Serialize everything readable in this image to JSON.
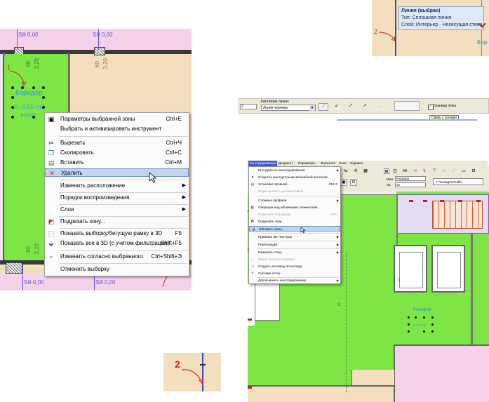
{
  "floor_plan_left": {
    "sill_labels": [
      "Sill 0,00",
      "Sill 0,00",
      "Sill 0,00",
      "Sill 0,00"
    ],
    "dim_labels": [
      "60",
      "3,20",
      "60",
      "3,20",
      "60",
      "3,20"
    ],
    "zone_name": "Коридор",
    "zone_area": "A: 9,55 m2",
    "zone_extra": "корид",
    "marker": "1",
    "colors": {
      "zone": "#7ee644",
      "room": "#f3dfbd",
      "corridor": "#f5d2ea",
      "sill": "#6a4fd8"
    }
  },
  "context_menu": {
    "items": [
      {
        "icon": "zone-settings-icon",
        "label": "Параметры выбранной зоны",
        "shortcut": "Ctrl+E"
      },
      {
        "icon": "",
        "label": "Выбрать и активизировать инструмент",
        "shortcut": ""
      },
      {
        "icon": "scissors-icon",
        "label": "Вырезать",
        "shortcut": "Ctrl+Ч"
      },
      {
        "icon": "copy-icon",
        "label": "Скопировать",
        "shortcut": "Ctrl+С"
      },
      {
        "icon": "paste-icon",
        "label": "Вставить",
        "shortcut": "Ctrl+М"
      },
      {
        "icon": "delete-x-icon",
        "label": "Удалить",
        "shortcut": ""
      },
      {
        "icon": "",
        "label": "Изменить расположение",
        "shortcut": ""
      },
      {
        "icon": "",
        "label": "Порядок воспроизведения",
        "shortcut": ""
      },
      {
        "icon": "",
        "label": "Слои",
        "shortcut": ""
      },
      {
        "icon": "trim-zone-icon",
        "label": "Подрезать зону...",
        "shortcut": ""
      },
      {
        "icon": "3d-window-icon",
        "label": "Показать выборку/бегущую рамку в 3D",
        "shortcut": "F5"
      },
      {
        "icon": "3d-all-icon",
        "label": "Показать все в 3D (с учетом фильтрации)",
        "shortcut": "Shift+F5"
      },
      {
        "icon": "modify-selected-icon",
        "label": "Изменить согласно выбранного",
        "shortcut": "Ctrl+Shift+Э"
      },
      {
        "icon": "",
        "label": "Отменить выборку",
        "shortcut": ""
      }
    ]
  },
  "tooltip_top_right": {
    "title": "Линия (выбран)",
    "line1": "Тип: Сплошная линия",
    "line2": "Слой: Интерьер - Несесущая стена",
    "marker": "2",
    "side_label": "Кор"
  },
  "line_toolbar": {
    "left_value": "2",
    "category_label": "Категория линии:",
    "category_value": "Линия чертежа",
    "checkbox_label": "Граница зоны",
    "tooltip": "Связь с зонами"
  },
  "small_detail": {
    "marker": "2"
  },
  "app_window": {
    "menubar": [
      "Конструирование",
      "Документ",
      "Параметры",
      "Teamwork",
      "Окно",
      "Справка"
    ],
    "name_label": "Имя:",
    "name_value": "Коридор",
    "number_label": "№:",
    "number_value": "02",
    "category_value": "7  Passages/Traffic",
    "menu_items": [
      {
        "icon": "tools-icon",
        "label": "Инструменты конструирования",
        "shortcut": "",
        "state": "normal"
      },
      {
        "icon": "magic-wand-icon",
        "label": "Очертить многоугольник волшебной палочкой",
        "shortcut": "",
        "state": "normal"
      },
      {
        "icon": "level-icon",
        "label": "Установка Уровней...",
        "shortcut": "Ctrl+7",
        "state": "normal"
      },
      {
        "icon": "",
        "label": "Редактировать уровни этажей",
        "shortcut": "",
        "state": "disabled"
      },
      {
        "icon": "",
        "label": "Сложные профили",
        "shortcut": "",
        "state": "normal"
      },
      {
        "icon": "operations-icon",
        "label": "Операции над объемными элементами...",
        "shortcut": "",
        "state": "normal"
      },
      {
        "icon": "",
        "label": "Подрезать под крышу",
        "shortcut": "Ctrl+\\",
        "state": "disabled"
      },
      {
        "icon": "trim-zone-icon",
        "label": "Подрезать зону...",
        "shortcut": "",
        "state": "normal"
      },
      {
        "icon": "update-zones-icon",
        "label": "Обновить зоны...",
        "shortcut": "",
        "state": "highlight"
      },
      {
        "icon": "",
        "label": "Привязка 3D-текстуры",
        "shortcut": "",
        "state": "normal"
      },
      {
        "icon": "",
        "label": "Перегородка",
        "shortcut": "",
        "state": "normal"
      },
      {
        "icon": "",
        "label": "Изменить стену",
        "shortcut": "",
        "state": "normal"
      },
      {
        "icon": "roof-icon",
        "label": "Линия плоскости кровли",
        "shortcut": "",
        "state": "disabled"
      },
      {
        "icon": "stair-icon",
        "label": "Создать лестницу по контуру",
        "shortcut": "",
        "state": "normal"
      },
      {
        "icon": "grid-icon",
        "label": "Система сеток...",
        "shortcut": "",
        "state": "normal"
      },
      {
        "icon": "",
        "label": "Дополнения к конструированию",
        "shortcut": "",
        "state": "normal"
      }
    ],
    "zone_name": "Коридор",
    "zone_area": "8,08 m2",
    "marker_1": "1",
    "marker_2": "2"
  }
}
